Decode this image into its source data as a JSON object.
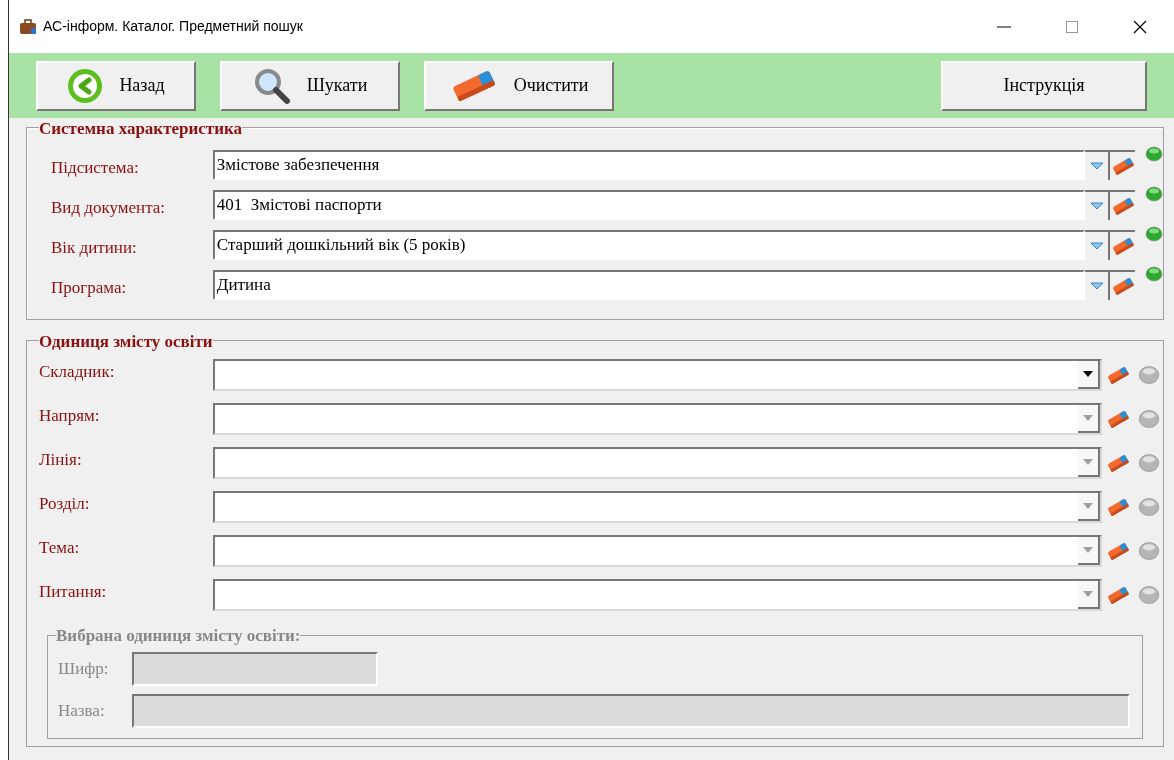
{
  "window": {
    "title": "АС-інформ. Каталог. Предметний пошук"
  },
  "toolbar": {
    "buttons": [
      {
        "label": "Назад",
        "kind": "back"
      },
      {
        "label": "Шукати",
        "kind": "search"
      },
      {
        "label": "Очистити",
        "kind": "clear"
      }
    ],
    "help_button": {
      "label": "Інструкція"
    }
  },
  "system_section": {
    "title": "Системна характеристика",
    "fields": [
      {
        "label": "Підсистема:",
        "value": "Змістове забезпечення",
        "active": true
      },
      {
        "label": "Вид документа:",
        "value": "401  Змістові паспорти",
        "active": true
      },
      {
        "label": "Вік дитини:",
        "value": "Старший дошкільний вік (5 років)",
        "active": true
      },
      {
        "label": "Програма:",
        "value": "Дитина",
        "active": true
      }
    ]
  },
  "unit_section": {
    "title": "Одиниця змісту освіти",
    "fields": [
      {
        "label": "Складник:",
        "enabled": true,
        "active": false
      },
      {
        "label": "Напрям:",
        "enabled": false,
        "active": false
      },
      {
        "label": "Лінія:",
        "enabled": false,
        "active": false
      },
      {
        "label": "Розділ:",
        "enabled": false,
        "active": false
      },
      {
        "label": "Тема:",
        "enabled": false,
        "active": false
      },
      {
        "label": "Питання:",
        "enabled": false,
        "active": false
      }
    ],
    "selected": {
      "title": "Вибрана одиниця змісту освіти:",
      "fields": [
        {
          "label": "Шифр:"
        },
        {
          "label": "Назва:"
        }
      ]
    }
  }
}
